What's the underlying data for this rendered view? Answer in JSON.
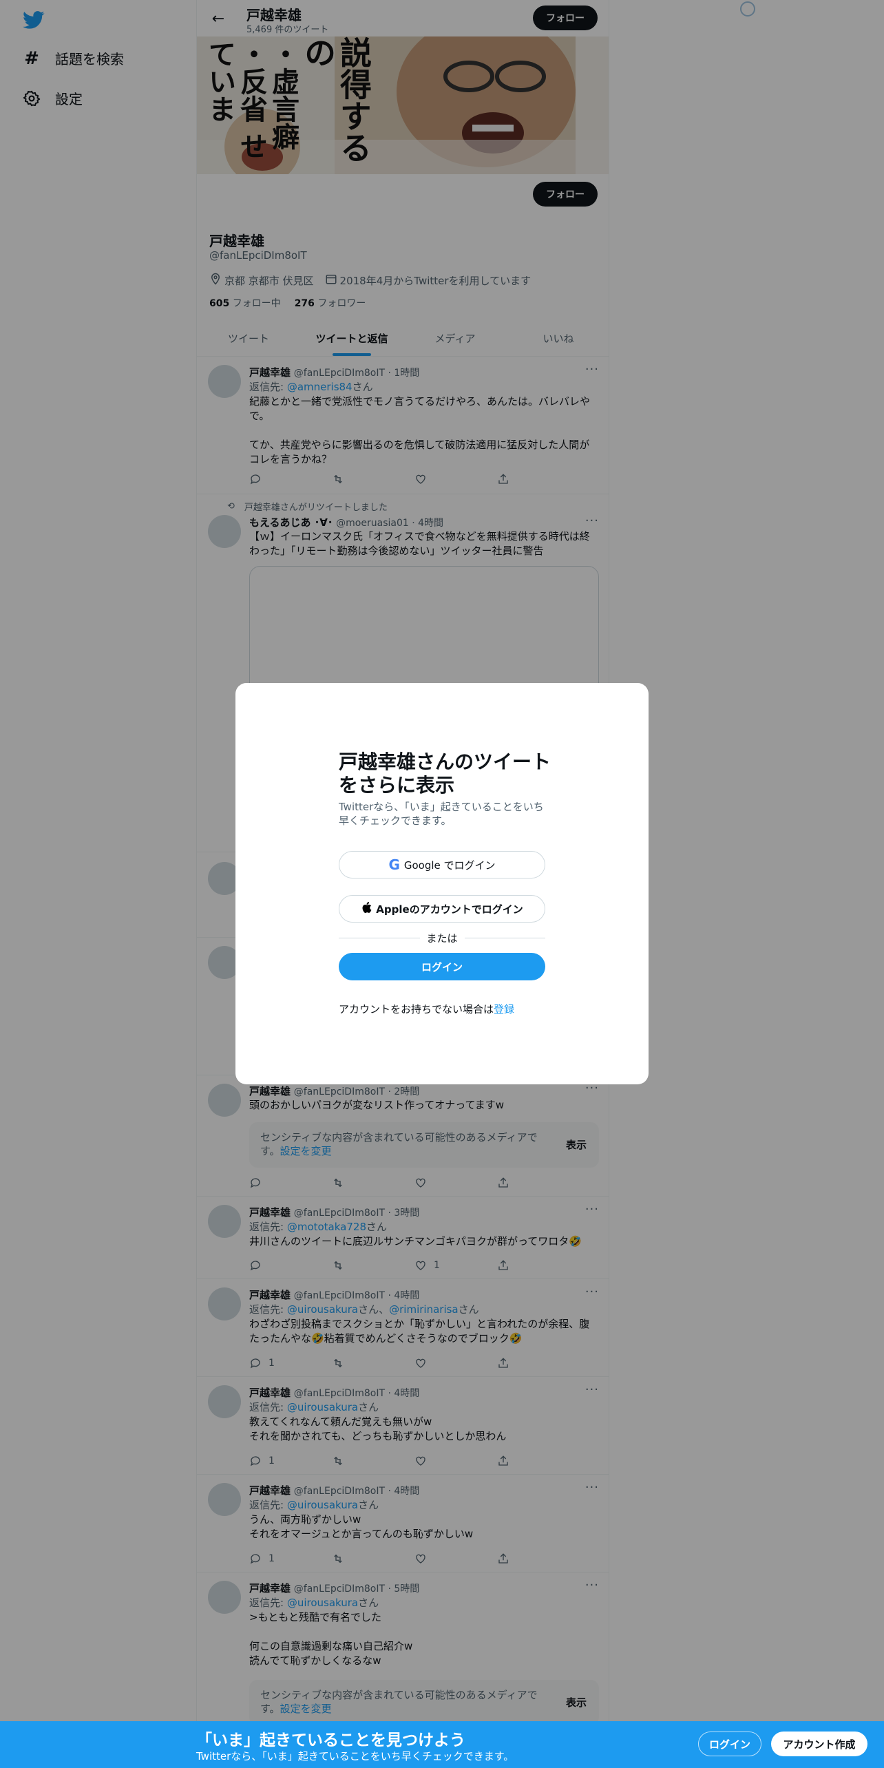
{
  "sidebar": {
    "logo": "twitter-bird",
    "items": [
      {
        "label": "話題を検索",
        "icon": "hashtag-icon"
      },
      {
        "label": "設定",
        "icon": "gear-icon"
      }
    ]
  },
  "header": {
    "name": "戸越幸雄",
    "tweet_count": "5,469 件のツイート",
    "follow_label": "フォロー"
  },
  "profile": {
    "follow_label": "フォロー",
    "name": "戸越幸雄",
    "handle": "@fanLEpciDIm8oIT",
    "location": "京都 京都市 伏見区",
    "joined": "2018年4月からTwitterを利用しています",
    "following_count": "605",
    "following_label": "フォロー中",
    "followers_count": "276",
    "followers_label": "フォロワー",
    "banner_text": [
      "説得するの",
      "・虚言癖",
      "・反省",
      "せていま"
    ]
  },
  "tabs": [
    {
      "label": "ツイート",
      "active": false
    },
    {
      "label": "ツイートと返信",
      "active": true
    },
    {
      "label": "メディア",
      "active": false
    },
    {
      "label": "いいね",
      "active": false
    }
  ],
  "tweets": [
    {
      "name": "戸越幸雄",
      "meta": "@fanLEpciDIm8oIT · 1時間",
      "reply_prefix": "返信先: ",
      "reply_to": "@amneris84",
      "reply_suffix": "さん",
      "text": "紀藤とかと一緒で党派性でモノ言うてるだけやろ、あんたは。バレバレやで。\n\nてか、共産党やらに影響出るのを危惧して破防法適用に猛反対した人間がコレを言うかね？"
    },
    {
      "retweet_note": "戸越幸雄さんがリツイートしました",
      "name": "もえるあじあ ･∀･",
      "meta": "@moeruasia01 · 4時間",
      "text": "【ｗ】イーロンマスク氏「オフィスで食べ物などを無料提供する時代は終わった」「リモート勤務は今後認めない」ツイッター社員に警告"
    },
    {
      "name": "戸越幸雄",
      "meta": "@fanLEpciDIm8oIT · 2時間",
      "text": "頭のおかしいパヨクが変なリスト作ってオナってますw",
      "sensitive_text": "センシティブな内容が含まれている可能性のあるメディアです。",
      "sensitive_link": "設定を変更",
      "show_label": "表示"
    },
    {
      "name": "戸越幸雄",
      "meta": "@fanLEpciDIm8oIT · 3時間",
      "reply_prefix": "返信先: ",
      "reply_to": "@mototaka728",
      "reply_suffix": "さん",
      "text": "井川さんのツイートに底辺ルサンチマンゴキパヨクが群がってワロタ🤣",
      "like_count": "1"
    },
    {
      "name": "戸越幸雄",
      "meta": "@fanLEpciDIm8oIT · 4時間",
      "reply_prefix": "返信先: ",
      "reply_to": "@uirousakura",
      "reply_mid": "さん、",
      "reply_to2": "@rimirinarisa",
      "reply_suffix": "さん",
      "text": "わざわざ別投稿までスクショとか「恥ずかしい」と言われたのが余程、腹たったんやな🤣粘着質でめんどくさそうなのでブロック🤣",
      "reply_count": "1"
    },
    {
      "name": "戸越幸雄",
      "meta": "@fanLEpciDIm8oIT · 4時間",
      "reply_prefix": "返信先: ",
      "reply_to": "@uirousakura",
      "reply_suffix": "さん",
      "text": "教えてくれなんて頼んだ覚えも無いがw\nそれを聞かされても、どっちも恥ずかしいとしか思わん",
      "reply_count": "1"
    },
    {
      "name": "戸越幸雄",
      "meta": "@fanLEpciDIm8oIT · 4時間",
      "reply_prefix": "返信先: ",
      "reply_to": "@uirousakura",
      "reply_suffix": "さん",
      "text": "うん、両方恥ずかしいw\nそれをオマージュとか言ってんのも恥ずかしいw",
      "reply_count": "1"
    },
    {
      "name": "戸越幸雄",
      "meta": "@fanLEpciDIm8oIT · 5時間",
      "reply_prefix": "返信先: ",
      "reply_to": "@uirousakura",
      "reply_suffix": "さん",
      "text": ">もともと残酷で有名でした\n\n何この自意識過剰な痛い自己紹介w\n読んでて恥ずかしくなるなw",
      "sensitive_text": "センシティブな内容が含まれている可能性のあるメディアです。",
      "sensitive_link": "設定を変更",
      "show_label": "表示"
    }
  ],
  "modal": {
    "title": "戸越幸雄さんのツイートをさらに表示",
    "subtitle": "Twitterなら、「いま」起きていることをいち早くチェックできます。",
    "google_label": "Google でログイン",
    "apple_label": "Appleのアカウントでログイン",
    "or_label": "または",
    "login_label": "ログイン",
    "signup_prompt": "アカウントをお持ちでない場合は",
    "signup_link": "登録"
  },
  "bottom_bar": {
    "title": "「いま」起きていることを見つけよう",
    "subtitle": "Twitterなら、「いま」起きていることをいち早くチェックできます。",
    "login_label": "ログイン",
    "signup_label": "アカウント作成"
  },
  "colors": {
    "accent": "#1d9bf0",
    "text": "#0f1419",
    "secondary": "#536471"
  }
}
